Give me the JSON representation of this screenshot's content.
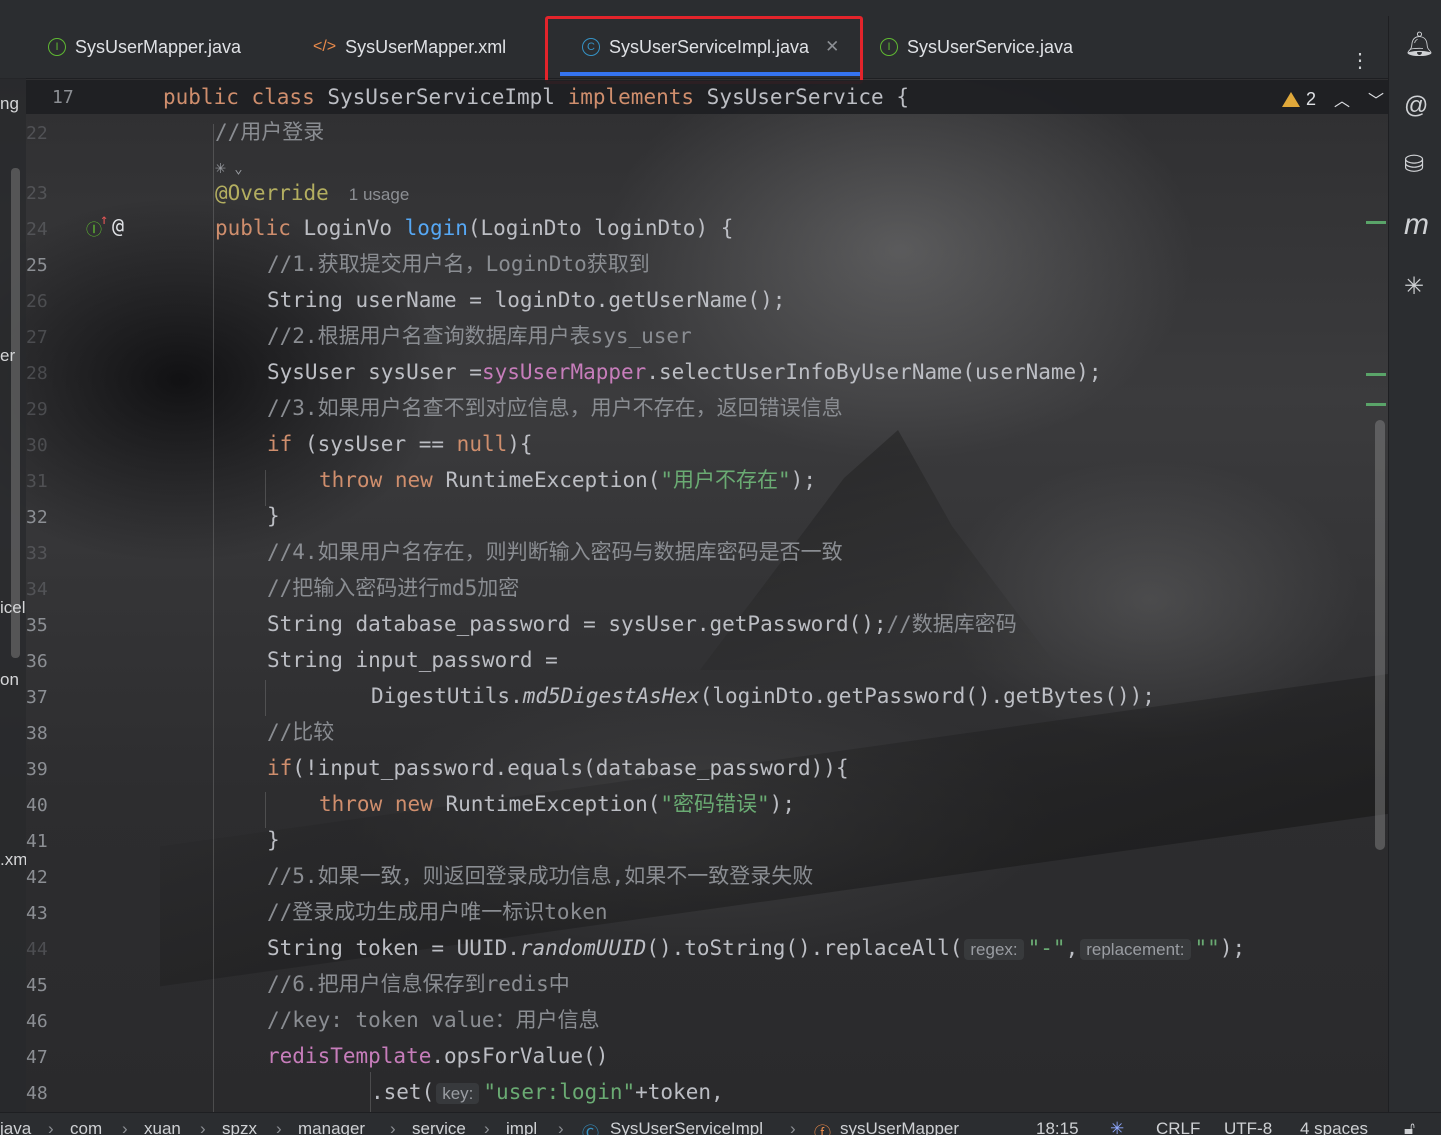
{
  "tabs": [
    {
      "label": "SysUserMapper.java",
      "icon": "interface-icon"
    },
    {
      "label": "SysUserMapper.xml",
      "icon": "xml-icon"
    },
    {
      "label": "SysUserServiceImpl.java",
      "icon": "class-icon",
      "active": true
    },
    {
      "label": "SysUserService.java",
      "icon": "interface-icon"
    }
  ],
  "left_panel": {
    "fragments": [
      "ng",
      "er",
      "icel",
      "on",
      ".xm"
    ]
  },
  "sticky": {
    "line_no": "17",
    "warning_count": "2"
  },
  "line_numbers": [
    "22",
    "23",
    "24",
    "25",
    "26",
    "27",
    "28",
    "29",
    "30",
    "31",
    "32",
    "33",
    "34",
    "35",
    "36",
    "37",
    "38",
    "39",
    "40",
    "41",
    "42",
    "43",
    "44",
    "45",
    "46",
    "47",
    "48"
  ],
  "code": {
    "c22": "//用户登录",
    "ann": "@Override",
    "usage": "1 usage",
    "sig_kw": "public",
    "sig_type": " LoginVo ",
    "sig_fn": "login",
    "sig_rest": "(LoginDto loginDto) {",
    "c25": "//1.获取提交用户名，LoginDto获取到",
    "l26": "String userName = loginDto.getUserName();",
    "c27": "//2.根据用户名查询数据库用户表sys_user",
    "l28a": "SysUser sysUser =",
    "l28f": "sysUserMapper",
    "l28b": ".selectUserInfoByUserName(userName);",
    "c29": "//3.如果用户名查不到对应信息，用户不存在，返回错误信息",
    "if_kw": "if",
    "l30a": " (sysUser == ",
    "null_kw": "null",
    "l30b": "){",
    "throw_kw": "throw",
    "new_kw": " new",
    "rte": " RuntimeException(",
    "s31": "\"用户不存在\"",
    "end_paren": ");",
    "brace": "}",
    "c33": "//4.如果用户名存在，则判断输入密码与数据库密码是否一致",
    "c34": "//把输入密码进行md5加密",
    "l35": "String database_password = sysUser.getPassword();",
    "c35": "//数据库密码",
    "l36": "String input_password =",
    "l37a": "DigestUtils.",
    "l37m": "md5DigestAsHex",
    "l37b": "(loginDto.getPassword().getBytes());",
    "c38": "//比较",
    "l39": "(!input_password.equals(database_password)){",
    "s40": "\"密码错误\"",
    "c42": "//5.如果一致，则返回登录成功信息,如果不一致登录失败",
    "c43": "//登录成功生成用户唯一标识token",
    "l44a": "String token = UUID.",
    "l44m": "randomUUID",
    "l44b": "().toString().replaceAll(",
    "h_regex": "regex:",
    "s44a": "\"-\"",
    "comma": ",",
    "h_repl": "replacement:",
    "s44b": "\"\"",
    "c45": "//6.把用户信息保存到redis中",
    "c46": "//key: token value：用户信息",
    "l47f": "redisTemplate",
    "l47b": ".opsForValue()",
    "l48a": ".set(",
    "h_key": "key:",
    "s48": "\"user:login\"",
    "l48b": "+token,"
  },
  "sticky_code": {
    "kw1": "public class",
    "name": " SysUserServiceImpl ",
    "kw2": "implements",
    "rest": " SysUserService {"
  },
  "breadcrumbs": [
    "java",
    "com",
    "xuan",
    "spzx",
    "manager",
    "service",
    "impl",
    "SysUserServiceImpl",
    "sysUserMapper"
  ],
  "status": {
    "position": "18:15",
    "line_sep": "CRLF",
    "encoding": "UTF-8",
    "indent": "4 spaces"
  },
  "colors": {
    "accent": "#3574f0",
    "highlight_box": "#e3242b",
    "keyword": "#cf8e6d",
    "string": "#6aab73",
    "comment": "#8a8d92",
    "field": "#c77dbb"
  }
}
